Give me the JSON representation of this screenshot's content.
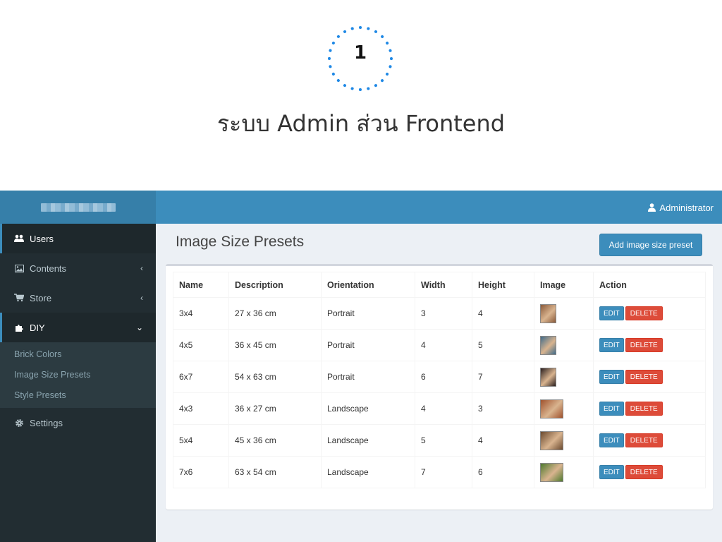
{
  "slide": {
    "step_number": "1",
    "title": "ระบบ Admin ส่วน Frontend",
    "badge_color": "#1e88e5"
  },
  "header": {
    "user_name": "Administrator",
    "user_icon": "user-icon",
    "brand_color": "#3c8dbc"
  },
  "sidebar": {
    "items": [
      {
        "label": "Users",
        "icon": "users-icon"
      },
      {
        "label": "Contents",
        "icon": "image-icon"
      },
      {
        "label": "Store",
        "icon": "cart-icon"
      },
      {
        "label": "DIY",
        "icon": "puzzle-icon"
      },
      {
        "label": "Settings",
        "icon": "gear-icon"
      }
    ],
    "diy_submenu": [
      "Brick Colors",
      "Image Size Presets",
      "Style Presets"
    ]
  },
  "main": {
    "title": "Image Size Presets",
    "add_button": "Add image size preset",
    "columns": [
      "Name",
      "Description",
      "Orientation",
      "Width",
      "Height",
      "Image",
      "Action"
    ],
    "rows": [
      {
        "name": "3x4",
        "description": "27 x 36 cm",
        "orientation": "Portrait",
        "width": "3",
        "height": "4",
        "thumb_color": "#8a5a3a"
      },
      {
        "name": "4x5",
        "description": "36 x 45 cm",
        "orientation": "Portrait",
        "width": "4",
        "height": "5",
        "thumb_color": "#3f6b8a"
      },
      {
        "name": "6x7",
        "description": "54 x 63 cm",
        "orientation": "Portrait",
        "width": "6",
        "height": "7",
        "thumb_color": "#2a1f1f"
      },
      {
        "name": "4x3",
        "description": "36 x 27 cm",
        "orientation": "Landscape",
        "width": "4",
        "height": "3",
        "thumb_color": "#a0522d"
      },
      {
        "name": "5x4",
        "description": "45 x 36 cm",
        "orientation": "Landscape",
        "width": "5",
        "height": "4",
        "thumb_color": "#6b4a2f"
      },
      {
        "name": "7x6",
        "description": "63 x 54 cm",
        "orientation": "Landscape",
        "width": "7",
        "height": "6",
        "thumb_color": "#4f7a2f"
      }
    ],
    "edit_label": "EDIT",
    "delete_label": "DELETE"
  }
}
